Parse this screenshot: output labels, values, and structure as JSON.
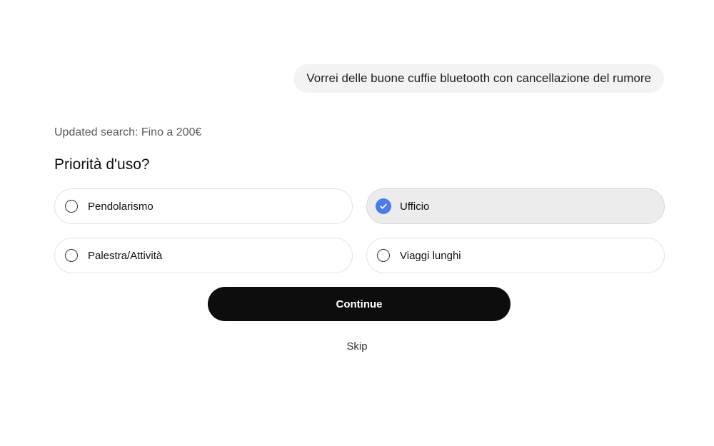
{
  "chat": {
    "user_message": "Vorrei delle buone cuffie bluetooth con cancellazione del rumore"
  },
  "status": {
    "updated_search": "Updated search: Fino a 200€"
  },
  "question": {
    "title": "Priorità d'uso?",
    "options": [
      {
        "label": "Pendolarismo",
        "selected": false
      },
      {
        "label": "Ufficio",
        "selected": true
      },
      {
        "label": "Palestra/Attività",
        "selected": false
      },
      {
        "label": "Viaggi lunghi",
        "selected": false
      }
    ]
  },
  "actions": {
    "continue_label": "Continue",
    "skip_label": "Skip"
  },
  "colors": {
    "accent": "#4a7cf0",
    "button_bg": "#0d0d0d",
    "selected_bg": "#ececec"
  }
}
